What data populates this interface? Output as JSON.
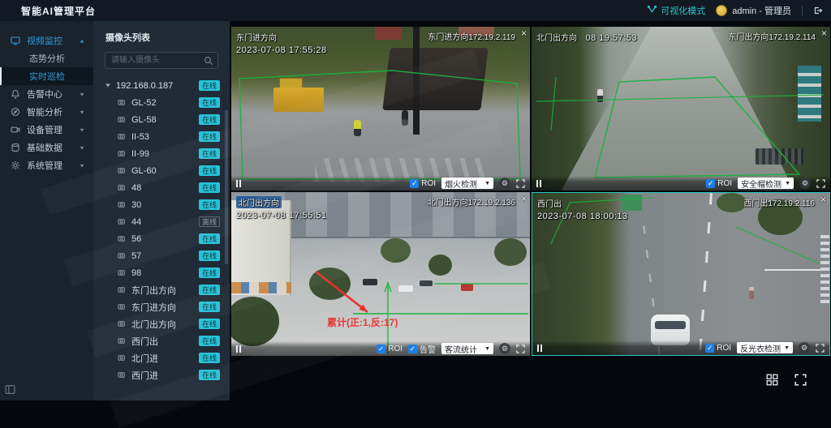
{
  "header": {
    "title": "智能AI管理平台",
    "mode_label": "可视化模式",
    "user_label": "admin - 管理员"
  },
  "sidebar": {
    "group_label": "视频监控",
    "sub_items": [
      {
        "label": "态势分析"
      },
      {
        "label": "实时巡检"
      }
    ],
    "items": [
      {
        "label": "告警中心"
      },
      {
        "label": "智能分析"
      },
      {
        "label": "设备管理"
      },
      {
        "label": "基础数据"
      },
      {
        "label": "系统管理"
      }
    ]
  },
  "camera_panel": {
    "title": "摄像头列表",
    "search_placeholder": "请输入摄像头",
    "root_label": "192.168.0.187",
    "root_status": "在线",
    "cameras": [
      {
        "name": "GL-52",
        "status": "在线"
      },
      {
        "name": "GL-58",
        "status": "在线"
      },
      {
        "name": "II-53",
        "status": "在线"
      },
      {
        "name": "II-99",
        "status": "在线"
      },
      {
        "name": "GL-60",
        "status": "在线"
      },
      {
        "name": "48",
        "status": "在线"
      },
      {
        "name": "30",
        "status": "在线"
      },
      {
        "name": "44",
        "status": "离线"
      },
      {
        "name": "56",
        "status": "在线"
      },
      {
        "name": "57",
        "status": "在线"
      },
      {
        "name": "98",
        "status": "在线"
      },
      {
        "name": "东门出方向",
        "status": "在线"
      },
      {
        "name": "东门进方向",
        "status": "在线"
      },
      {
        "name": "北门出方向",
        "status": "在线"
      },
      {
        "name": "西门出",
        "status": "在线"
      },
      {
        "name": "北门进",
        "status": "在线"
      },
      {
        "name": "西门进",
        "status": "在线"
      }
    ]
  },
  "videos": [
    {
      "osd_name": "东门进方向",
      "osd_time": "2023-07-08 17:55:28",
      "label": "东门进方向172.19.2.119",
      "close": "×",
      "roi_label": "ROI",
      "algorithm": "烟火检测"
    },
    {
      "osd_name": "北门出方向",
      "osd_time": "08 19:57:53",
      "label": "东门出方向172.19.2.114",
      "close": "×",
      "roi_label": "ROI",
      "algorithm": "安全帽检测"
    },
    {
      "osd_name": "北门出方向",
      "osd_time": "2023-07-08 17:55:51",
      "label": "北门出方向172.19.2.136",
      "close": "×",
      "roi_label": "ROI",
      "alarm_label": "告警",
      "algorithm": "客流统计",
      "annotation": "累计(正:1,反:17)"
    },
    {
      "osd_name": "西门出",
      "osd_time": "2023-07-08 18:00:13",
      "label": "西门出172.19.2.116",
      "close": "×",
      "roi_label": "ROI",
      "algorithm": "反光衣检测"
    }
  ],
  "colors": {
    "accent_blue": "#2f9ade",
    "teal": "#29c6c8",
    "online_badge": "#27c3d8",
    "roi_green": "#17b33c",
    "alert_red": "#e8312f",
    "selected_border": "#28c7c0"
  }
}
